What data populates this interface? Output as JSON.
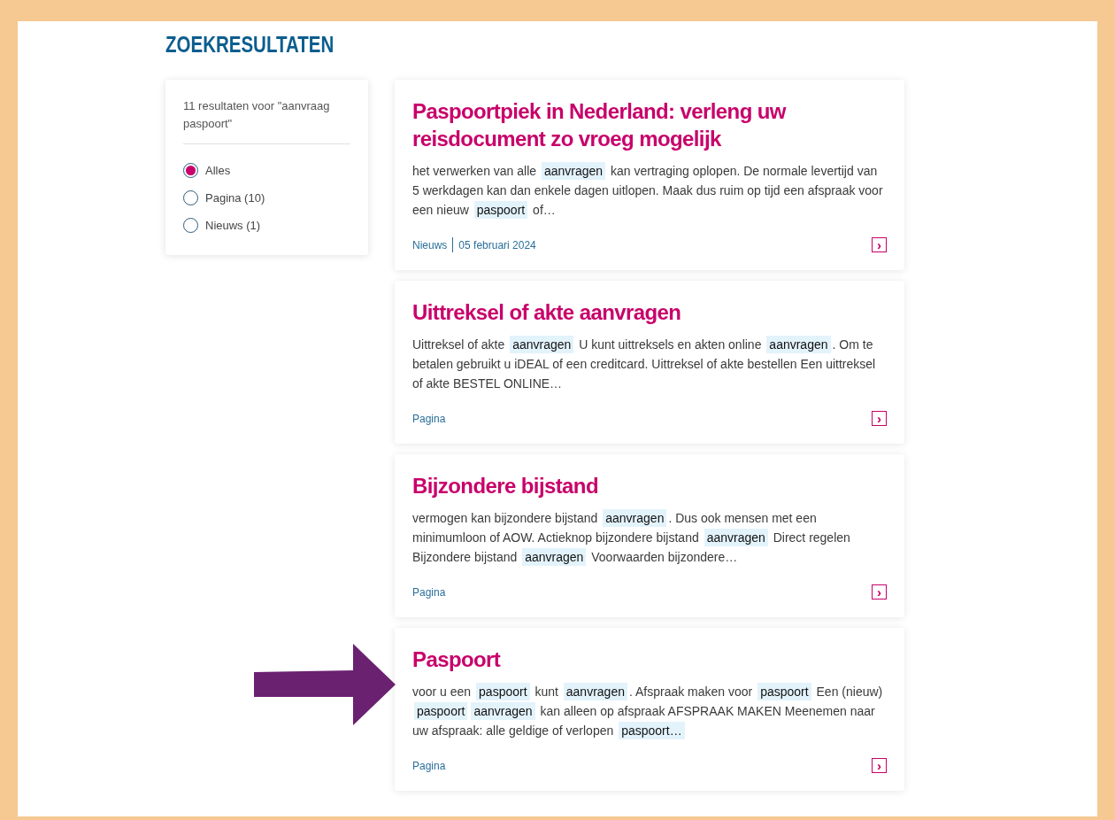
{
  "page": {
    "title": "ZOEKRESULTATEN"
  },
  "filter": {
    "summary": "11 resultaten voor \"aanvraag paspoort\"",
    "options": [
      {
        "label": "Alles",
        "selected": true
      },
      {
        "label": "Pagina (10)",
        "selected": false
      },
      {
        "label": "Nieuws (1)",
        "selected": false
      }
    ]
  },
  "results": [
    {
      "title": "Paspoortpiek in Nederland: verleng uw reisdocument zo vroeg mogelijk",
      "snippet": [
        {
          "text": "het verwerken van alle ",
          "highlight": false
        },
        {
          "text": "aanvragen",
          "highlight": true
        },
        {
          "text": " kan vertraging oplopen. De normale levertijd van 5 werkdagen kan dan enkele dagen uitlopen. Maak dus ruim op tijd een afspraak voor een nieuw ",
          "highlight": false
        },
        {
          "text": "paspoort",
          "highlight": true
        },
        {
          "text": " of…",
          "highlight": false
        }
      ],
      "type": "Nieuws",
      "date": "05 februari 2024",
      "arrow": "›"
    },
    {
      "title": "Uittreksel of akte aanvragen",
      "snippet": [
        {
          "text": "Uittreksel of akte ",
          "highlight": false
        },
        {
          "text": "aanvragen",
          "highlight": true
        },
        {
          "text": " U kunt uittreksels en akten online ",
          "highlight": false
        },
        {
          "text": "aanvragen",
          "highlight": true
        },
        {
          "text": ". Om te betalen gebruikt u iDEAL of een creditcard. Uittreksel of akte bestellen Een uittreksel of akte BESTEL ONLINE…",
          "highlight": false
        }
      ],
      "type": "Pagina",
      "arrow": "›"
    },
    {
      "title": "Bijzondere bijstand",
      "snippet": [
        {
          "text": "vermogen kan bijzondere bijstand ",
          "highlight": false
        },
        {
          "text": "aanvragen",
          "highlight": true
        },
        {
          "text": ". Dus ook mensen met een minimumloon of AOW. Actieknop bijzondere bijstand ",
          "highlight": false
        },
        {
          "text": "aanvragen",
          "highlight": true
        },
        {
          "text": " Direct regelen Bijzondere bijstand ",
          "highlight": false
        },
        {
          "text": "aanvragen",
          "highlight": true
        },
        {
          "text": " Voorwaarden bijzondere…",
          "highlight": false
        }
      ],
      "type": "Pagina",
      "arrow": "›"
    },
    {
      "title": "Paspoort",
      "snippet": [
        {
          "text": "voor u een ",
          "highlight": false
        },
        {
          "text": "paspoort",
          "highlight": true
        },
        {
          "text": " kunt ",
          "highlight": false
        },
        {
          "text": "aanvragen",
          "highlight": true
        },
        {
          "text": ". Afspraak maken voor ",
          "highlight": false
        },
        {
          "text": "paspoort",
          "highlight": true
        },
        {
          "text": " Een (nieuw) ",
          "highlight": false
        },
        {
          "text": "paspoort",
          "highlight": true
        },
        {
          "text": "aanvragen",
          "highlight": true
        },
        {
          "text": " kan alleen op afspraak AFSPRAAK MAKEN Meenemen naar uw afspraak: alle geldige of verlopen ",
          "highlight": false
        },
        {
          "text": "paspoort…",
          "highlight": true
        }
      ],
      "type": "Pagina",
      "arrow": "›"
    }
  ]
}
